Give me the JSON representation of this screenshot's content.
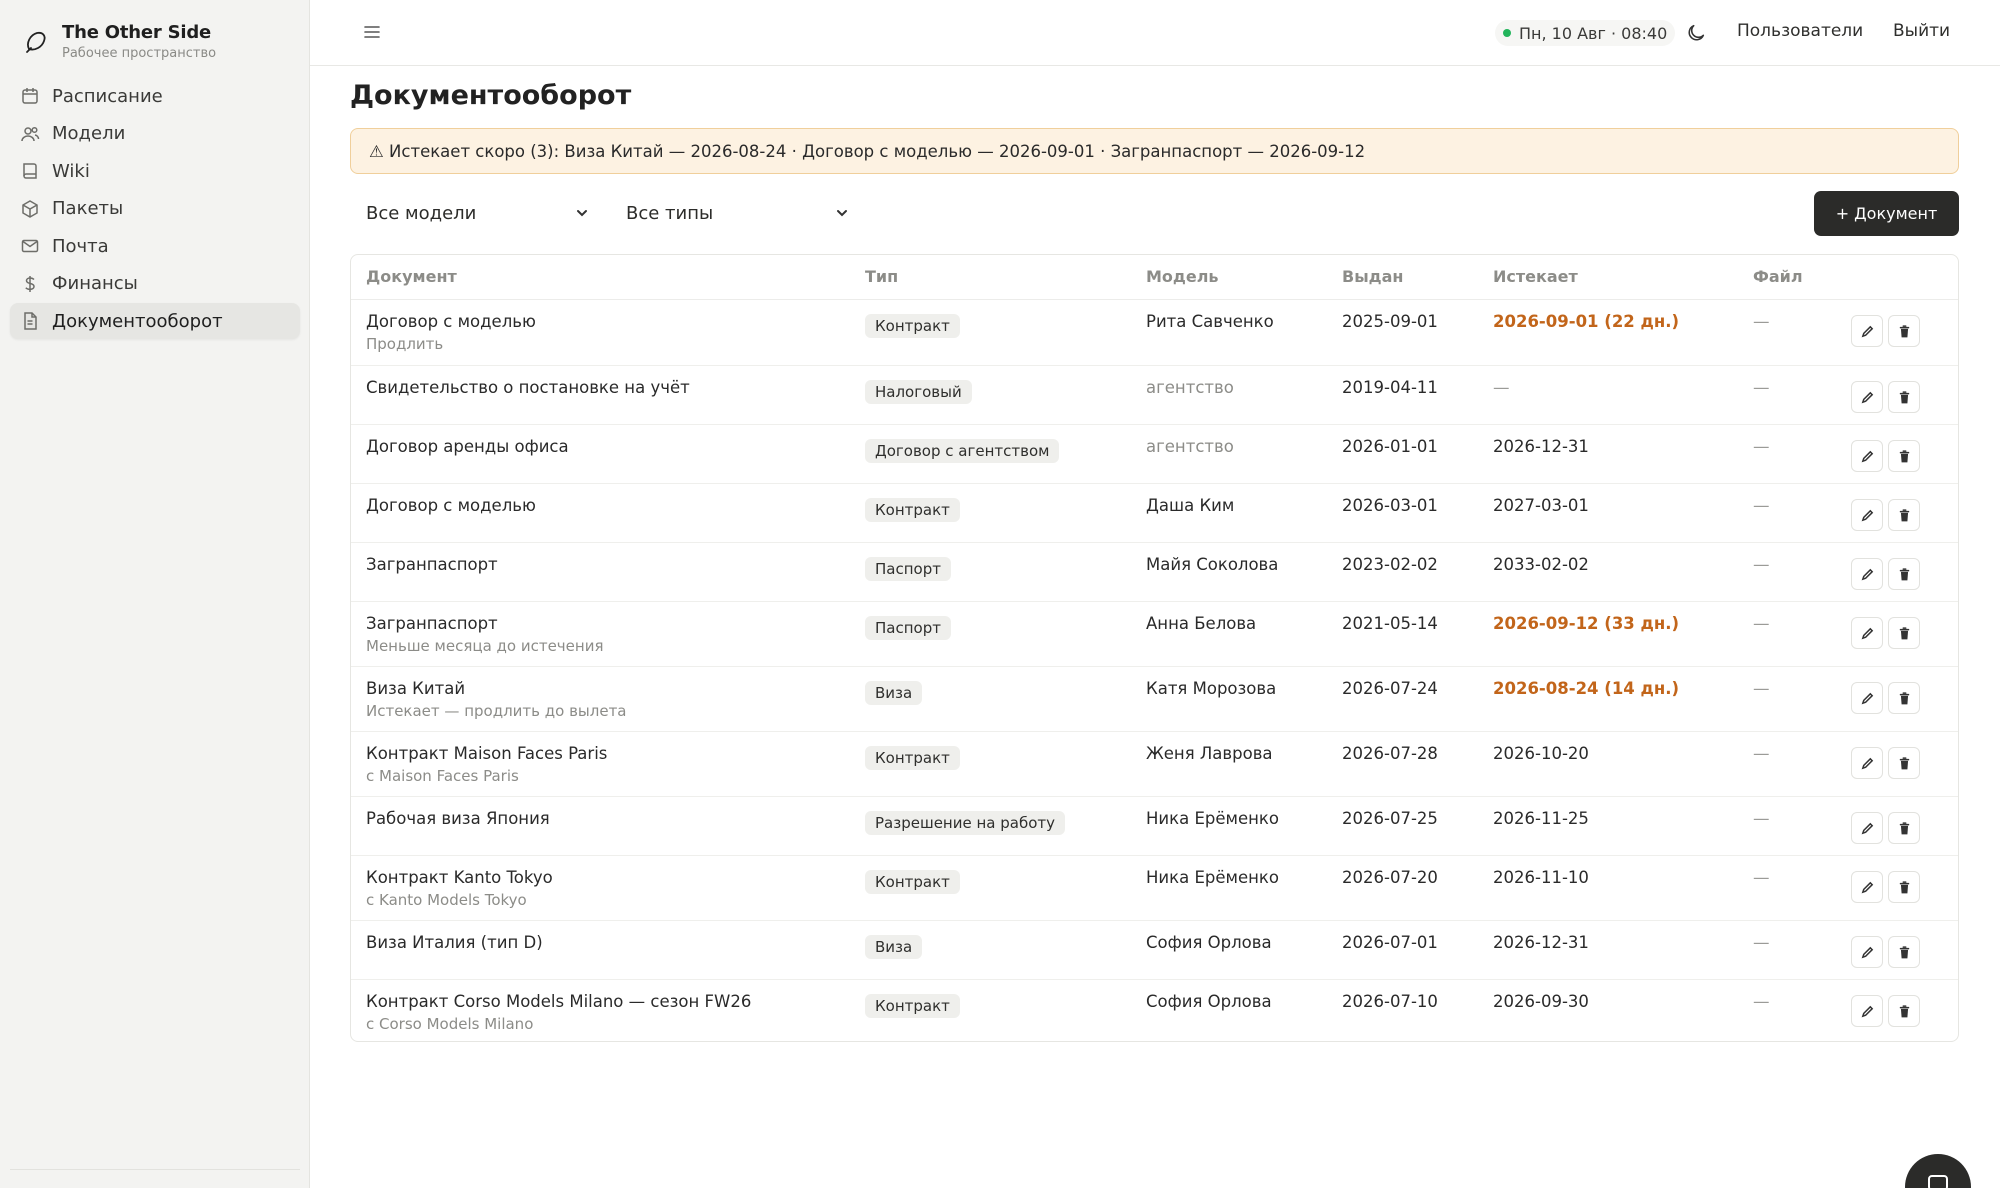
{
  "brand": {
    "name": "The Other Side",
    "subtitle": "Рабочее пространство"
  },
  "sidebar": {
    "items": [
      {
        "label": "Расписание",
        "icon": "calendar-icon",
        "active": false
      },
      {
        "label": "Модели",
        "icon": "users-icon",
        "active": false
      },
      {
        "label": "Wiki",
        "icon": "book-icon",
        "active": false
      },
      {
        "label": "Пакеты",
        "icon": "package-icon",
        "active": false
      },
      {
        "label": "Почта",
        "icon": "mail-icon",
        "active": false
      },
      {
        "label": "Финансы",
        "icon": "dollar-icon",
        "active": false
      },
      {
        "label": "Документооборот",
        "icon": "document-icon",
        "active": true
      }
    ]
  },
  "topbar": {
    "status": "Пн, 10 Авг · 08:40",
    "users_link": "Пользователи",
    "logout_link": "Выйти"
  },
  "main": {
    "title": "Документооборот",
    "alert": "⚠ Истекает скоро (3): Виза Китай — 2026-08-24 · Договор с моделью — 2026-09-01 · Загранпаспорт — 2026-09-12",
    "filters": {
      "model": "Все модели",
      "type": "Все типы"
    },
    "add_button": "+ Документ"
  },
  "table": {
    "columns": [
      "Документ",
      "Тип",
      "Модель",
      "Выдан",
      "Истекает",
      "Файл"
    ],
    "rows": [
      {
        "doc": "Договор с моделью",
        "sub": "Продлить",
        "type": "Контракт",
        "model": "Рита Савченко",
        "model_muted": false,
        "issued": "2025-09-01",
        "expires": "2026-09-01 (22 дн.)",
        "expires_warn": true,
        "file": "—"
      },
      {
        "doc": "Свидетельство о постановке на учёт",
        "sub": "",
        "type": "Налоговый",
        "model": "агентство",
        "model_muted": true,
        "issued": "2019-04-11",
        "expires": "—",
        "expires_warn": false,
        "file": "—"
      },
      {
        "doc": "Договор аренды офиса",
        "sub": "",
        "type": "Договор с агентством",
        "model": "агентство",
        "model_muted": true,
        "issued": "2026-01-01",
        "expires": "2026-12-31",
        "expires_warn": false,
        "file": "—"
      },
      {
        "doc": "Договор с моделью",
        "sub": "",
        "type": "Контракт",
        "model": "Даша Ким",
        "model_muted": false,
        "issued": "2026-03-01",
        "expires": "2027-03-01",
        "expires_warn": false,
        "file": "—"
      },
      {
        "doc": "Загранпаспорт",
        "sub": "",
        "type": "Паспорт",
        "model": "Майя Соколова",
        "model_muted": false,
        "issued": "2023-02-02",
        "expires": "2033-02-02",
        "expires_warn": false,
        "file": "—"
      },
      {
        "doc": "Загранпаспорт",
        "sub": "Меньше месяца до истечения",
        "type": "Паспорт",
        "model": "Анна Белова",
        "model_muted": false,
        "issued": "2021-05-14",
        "expires": "2026-09-12 (33 дн.)",
        "expires_warn": true,
        "file": "—"
      },
      {
        "doc": "Виза Китай",
        "sub": "Истекает — продлить до вылета",
        "type": "Виза",
        "model": "Катя Морозова",
        "model_muted": false,
        "issued": "2026-07-24",
        "expires": "2026-08-24 (14 дн.)",
        "expires_warn": true,
        "file": "—"
      },
      {
        "doc": "Контракт Maison Faces Paris",
        "sub": "с Maison Faces Paris",
        "type": "Контракт",
        "model": "Женя Лаврова",
        "model_muted": false,
        "issued": "2026-07-28",
        "expires": "2026-10-20",
        "expires_warn": false,
        "file": "—"
      },
      {
        "doc": "Рабочая виза Япония",
        "sub": "",
        "type": "Разрешение на работу",
        "model": "Ника Ерёменко",
        "model_muted": false,
        "issued": "2026-07-25",
        "expires": "2026-11-25",
        "expires_warn": false,
        "file": "—"
      },
      {
        "doc": "Контракт Kanto Tokyo",
        "sub": "с Kanto Models Tokyo",
        "type": "Контракт",
        "model": "Ника Ерёменко",
        "model_muted": false,
        "issued": "2026-07-20",
        "expires": "2026-11-10",
        "expires_warn": false,
        "file": "—"
      },
      {
        "doc": "Виза Италия (тип D)",
        "sub": "",
        "type": "Виза",
        "model": "София Орлова",
        "model_muted": false,
        "issued": "2026-07-01",
        "expires": "2026-12-31",
        "expires_warn": false,
        "file": "—"
      },
      {
        "doc": "Контракт Corso Models Milano — сезон FW26",
        "sub": "с Corso Models Milano",
        "type": "Контракт",
        "model": "София Орлова",
        "model_muted": false,
        "issued": "2026-07-10",
        "expires": "2026-09-30",
        "expires_warn": false,
        "file": "—"
      }
    ]
  },
  "colors": {
    "accent": "#2b2b29",
    "warning": "#c2651a",
    "alert_bg": "#fdf2e2",
    "alert_border": "#f0cf9b",
    "online": "#22b45b"
  }
}
